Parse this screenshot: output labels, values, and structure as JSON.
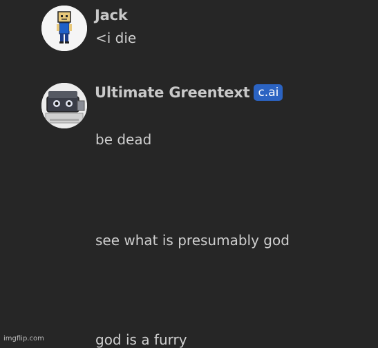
{
  "messages": [
    {
      "author": "Jack",
      "avatar_icon": "jack-avatar-icon",
      "lines": [
        "<i die"
      ]
    },
    {
      "author": "Ultimate Greentext",
      "badge": "c.ai",
      "avatar_icon": "greentext-avatar-icon",
      "lines": [
        "be dead",
        "see what is presumably god",
        "god is a furry"
      ]
    }
  ],
  "watermark": "imgflip.com",
  "colors": {
    "background": "#262626",
    "author_text": "#c9c9c9",
    "message_text": "#cfcfcf",
    "badge": "#2b63c2"
  }
}
